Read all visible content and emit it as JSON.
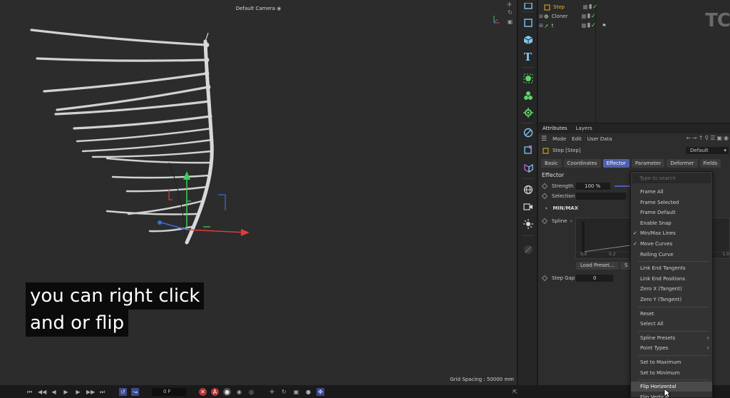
{
  "viewport": {
    "camera_label": "Default Camera",
    "camera_icon": "camera-icon",
    "grid_spacing": "Grid Spacing : 50000 mm",
    "subtitle_lines": [
      "you can right click",
      "and or flip"
    ]
  },
  "timeline": {
    "frame": "0 F"
  },
  "object_manager": {
    "objects": [
      {
        "name": "Step",
        "icon": "step-effector-icon",
        "color": "#e6b422",
        "enabled": true
      },
      {
        "name": "Cloner",
        "icon": "cloner-icon",
        "color": "#9bdb9b",
        "enabled": true
      },
      {
        "name": "t",
        "icon": "spline-object-icon",
        "color": "#cfcfcf",
        "enabled": true
      }
    ],
    "logo_text": "TC"
  },
  "attributes": {
    "tabs": [
      "Attributes",
      "Layers"
    ],
    "menu": [
      "Mode",
      "Edit",
      "User Data"
    ],
    "object_title": "Step [Step]",
    "preset": "Default",
    "section_tabs": [
      "Basic",
      "Coordinates",
      "Effector",
      "Parameter",
      "Deformer",
      "Fields"
    ],
    "active_tab": "Effector",
    "group_title": "Effector",
    "strength_label": "Strength",
    "strength_value": "100 %",
    "selection_label": "Selection",
    "minmax_label": "MIN/MAX",
    "spline_label": "Spline",
    "graph_ticks": [
      "0.0",
      "0.2",
      "1.0"
    ],
    "load_preset_label": "Load Preset...",
    "save_preset_label": "S",
    "step_gap_label": "Step Gap",
    "step_gap_value": "0"
  },
  "context_menu": {
    "search_placeholder": "Type to search",
    "items": [
      {
        "label": "Frame All"
      },
      {
        "label": "Frame Selected"
      },
      {
        "label": "Frame Default"
      },
      {
        "label": "Enable Snap"
      },
      {
        "label": "Min/Max Lines",
        "checked": true
      },
      {
        "label": "Move Curves",
        "checked": true
      },
      {
        "label": "Rolling Curve"
      },
      {
        "label": "Link End Tangents"
      },
      {
        "label": "Link End Positions"
      },
      {
        "label": "Zero X (Tangent)"
      },
      {
        "label": "Zero Y (Tangent)"
      },
      {
        "label": "Reset"
      },
      {
        "label": "Select All"
      },
      {
        "label": "Spline Presets",
        "submenu": true
      },
      {
        "label": "Point Types",
        "submenu": true
      },
      {
        "label": "Set to Maximum"
      },
      {
        "label": "Set to Minimum"
      },
      {
        "label": "Flip Horizontal",
        "highlighted": true
      },
      {
        "label": "Flip Vertical"
      }
    ]
  },
  "colors": {
    "accent": "#4f5fb0",
    "enabled_check": "#4ed15e",
    "toolbar_green": "#5fd16a",
    "toolbar_blue": "#7fc6f0",
    "axis_red": "#e03a3a",
    "axis_green": "#3ccf5a",
    "axis_blue": "#3a6ee0"
  }
}
